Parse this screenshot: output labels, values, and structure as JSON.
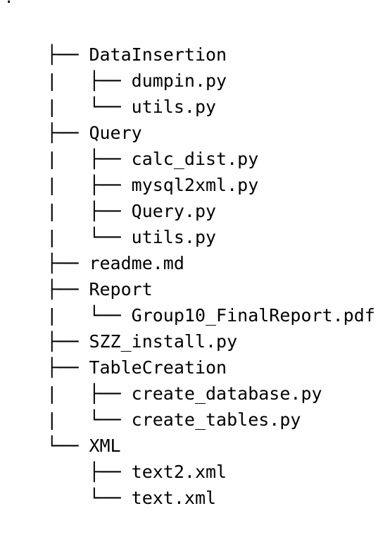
{
  "tree": {
    "root_marker": ".",
    "rows": [
      {
        "prefix": "├── ",
        "name": "DataInsertion"
      },
      {
        "prefix": "|   ├── ",
        "name": "dumpin.py"
      },
      {
        "prefix": "|   └── ",
        "name": "utils.py"
      },
      {
        "prefix": "├── ",
        "name": "Query"
      },
      {
        "prefix": "|   ├── ",
        "name": "calc_dist.py"
      },
      {
        "prefix": "|   ├── ",
        "name": "mysql2xml.py"
      },
      {
        "prefix": "|   ├── ",
        "name": "Query.py"
      },
      {
        "prefix": "|   └── ",
        "name": "utils.py"
      },
      {
        "prefix": "├── ",
        "name": "readme.md"
      },
      {
        "prefix": "├── ",
        "name": "Report"
      },
      {
        "prefix": "|   └── ",
        "name": "Group10_FinalReport.pdf"
      },
      {
        "prefix": "├── ",
        "name": "SZZ_install.py"
      },
      {
        "prefix": "├── ",
        "name": "TableCreation"
      },
      {
        "prefix": "|   ├── ",
        "name": "create_database.py"
      },
      {
        "prefix": "|   └── ",
        "name": "create_tables.py"
      },
      {
        "prefix": "└── ",
        "name": "XML"
      },
      {
        "prefix": "    ├── ",
        "name": "text2.xml"
      },
      {
        "prefix": "    └── ",
        "name": "text.xml"
      }
    ]
  }
}
